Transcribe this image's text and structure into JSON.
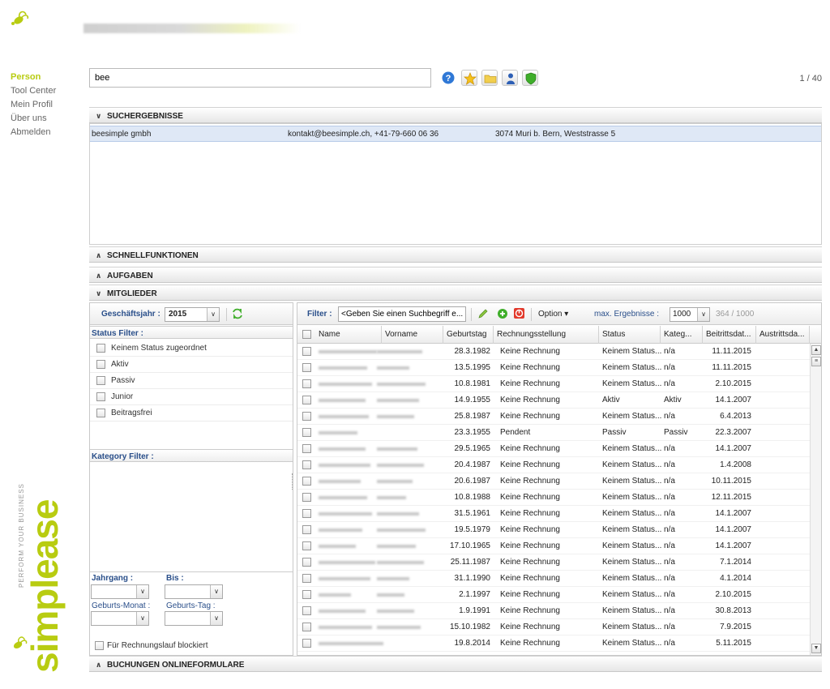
{
  "nav": {
    "items": [
      {
        "label": "Person",
        "active": true
      },
      {
        "label": "Tool Center"
      },
      {
        "label": "Mein Profil"
      },
      {
        "label": "Über uns"
      },
      {
        "label": "Abmelden"
      }
    ]
  },
  "brand": {
    "tagline": "PERFORM YOUR BUSINESS",
    "word": "simplease",
    "accent": "#b8cc11"
  },
  "search": {
    "value": "bee",
    "page_count": "1 / 40"
  },
  "toolbar": {
    "icons": [
      "help-icon",
      "star-icon",
      "folder-icon",
      "person-icon",
      "shield-icon"
    ]
  },
  "panels": {
    "results_title": "SUCHERGEBNISSE",
    "quick_title": "SCHNELLFUNKTIONEN",
    "tasks_title": "AUFGABEN",
    "members_title": "MITGLIEDER",
    "bookings_title": "BUCHUNGEN ONLINEFORMULARE"
  },
  "results": [
    {
      "name": "beesimple gmbh",
      "contact": "kontakt@beesimple.ch, +41-79-660 06 36",
      "address": "3074 Muri b. Bern, Weststrasse 5"
    }
  ],
  "members": {
    "year_label": "Geschäftsjahr :",
    "year_value": "2015",
    "status_filter_label": "Status Filter :",
    "status_options": [
      "Keinem Status zugeordnet",
      "Aktiv",
      "Passiv",
      "Junior",
      "Beitragsfrei"
    ],
    "category_filter_label": "Kategory Filter :",
    "jahrgang_label": "Jahrgang :",
    "bis_label": "Bis :",
    "geburts_monat_label": "Geburts-Monat :",
    "geburts_tag_label": "Geburts-Tag :",
    "blocked_label": "Für Rechnungslauf blockiert",
    "filter_label": "Filter :",
    "filter_placeholder": "<Geben Sie einen Suchbegriff e...",
    "option_label": "Option",
    "max_label": "max. Ergebnisse :",
    "max_value": "1000",
    "count": "364 / 1000",
    "columns": [
      "Name",
      "Vorname",
      "Geburtstag",
      "Rechnungsstellung",
      "Status",
      "Kateg...",
      "Beitrittsdat...",
      "Austrittsda..."
    ],
    "rows": [
      {
        "geburtstag": "28.3.1982",
        "rechnung": "Keine Rechnung",
        "status": "Keinem Status...",
        "kat": "n/a",
        "beitritt": "11.11.2015"
      },
      {
        "geburtstag": "13.5.1995",
        "rechnung": "Keine Rechnung",
        "status": "Keinem Status...",
        "kat": "n/a",
        "beitritt": "11.11.2015"
      },
      {
        "geburtstag": "10.8.1981",
        "rechnung": "Keine Rechnung",
        "status": "Keinem Status...",
        "kat": "n/a",
        "beitritt": "2.10.2015"
      },
      {
        "geburtstag": "14.9.1955",
        "rechnung": "Keine Rechnung",
        "status": "Aktiv",
        "kat": "Aktiv",
        "beitritt": "14.1.2007"
      },
      {
        "geburtstag": "25.8.1987",
        "rechnung": "Keine Rechnung",
        "status": "Keinem Status...",
        "kat": "n/a",
        "beitritt": "6.4.2013"
      },
      {
        "geburtstag": "23.3.1955",
        "rechnung": "Pendent",
        "status": "Passiv",
        "kat": "Passiv",
        "beitritt": "22.3.2007"
      },
      {
        "geburtstag": "29.5.1965",
        "rechnung": "Keine Rechnung",
        "status": "Keinem Status...",
        "kat": "n/a",
        "beitritt": "14.1.2007"
      },
      {
        "geburtstag": "20.4.1987",
        "rechnung": "Keine Rechnung",
        "status": "Keinem Status...",
        "kat": "n/a",
        "beitritt": "1.4.2008"
      },
      {
        "geburtstag": "20.6.1987",
        "rechnung": "Keine Rechnung",
        "status": "Keinem Status...",
        "kat": "n/a",
        "beitritt": "10.11.2015"
      },
      {
        "geburtstag": "10.8.1988",
        "rechnung": "Keine Rechnung",
        "status": "Keinem Status...",
        "kat": "n/a",
        "beitritt": "12.11.2015"
      },
      {
        "geburtstag": "31.5.1961",
        "rechnung": "Keine Rechnung",
        "status": "Keinem Status...",
        "kat": "n/a",
        "beitritt": "14.1.2007"
      },
      {
        "geburtstag": "19.5.1979",
        "rechnung": "Keine Rechnung",
        "status": "Keinem Status...",
        "kat": "n/a",
        "beitritt": "14.1.2007"
      },
      {
        "geburtstag": "17.10.1965",
        "rechnung": "Keine Rechnung",
        "status": "Keinem Status...",
        "kat": "n/a",
        "beitritt": "14.1.2007"
      },
      {
        "geburtstag": "25.11.1987",
        "rechnung": "Keine Rechnung",
        "status": "Keinem Status...",
        "kat": "n/a",
        "beitritt": "7.1.2014"
      },
      {
        "geburtstag": "31.1.1990",
        "rechnung": "Keine Rechnung",
        "status": "Keinem Status...",
        "kat": "n/a",
        "beitritt": "4.1.2014"
      },
      {
        "geburtstag": "2.1.1997",
        "rechnung": "Keine Rechnung",
        "status": "Keinem Status...",
        "kat": "n/a",
        "beitritt": "2.10.2015"
      },
      {
        "geburtstag": "1.9.1991",
        "rechnung": "Keine Rechnung",
        "status": "Keinem Status...",
        "kat": "n/a",
        "beitritt": "30.8.2013"
      },
      {
        "geburtstag": "15.10.1982",
        "rechnung": "Keine Rechnung",
        "status": "Keinem Status...",
        "kat": "n/a",
        "beitritt": "7.9.2015"
      },
      {
        "geburtstag": "19.8.2014",
        "rechnung": "Keine Rechnung",
        "status": "Keinem Status...",
        "kat": "n/a",
        "beitritt": "5.11.2015"
      }
    ]
  }
}
